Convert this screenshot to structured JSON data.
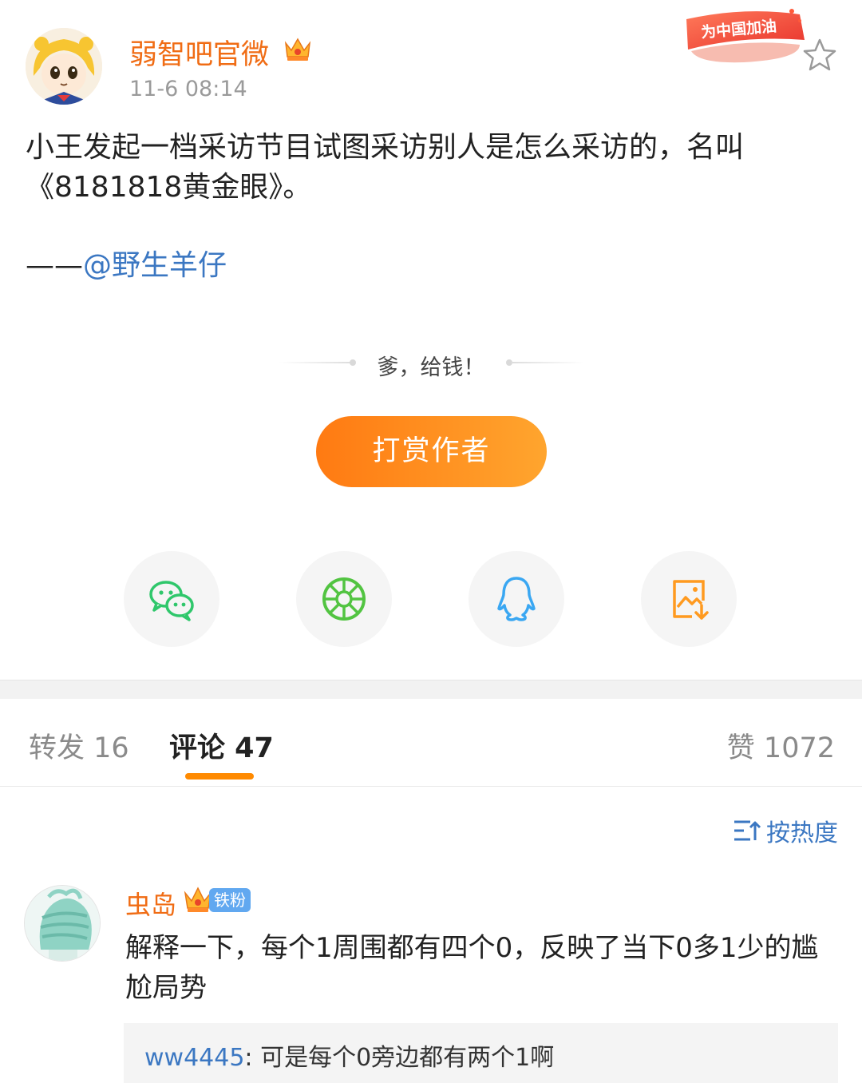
{
  "post": {
    "author": "弱智吧官微",
    "time": "11-6 08:14",
    "event_badge": "为中国加油",
    "body_lines": [
      "小王发起一档采访节目试图采访别人是怎么采访的，名叫",
      "《8181818黄金眼》。"
    ],
    "credit_dash": "——",
    "credit_mention": "@野生羊仔"
  },
  "reward": {
    "tip": "爹，给钱！",
    "button_label": "打赏作者"
  },
  "share": {
    "icons": [
      "wechat-icon",
      "moments-icon",
      "qq-icon",
      "save-image-icon"
    ]
  },
  "tabs": {
    "repost": "转发 16",
    "comment": "评论 47",
    "like": "赞 1072"
  },
  "sort": {
    "label": "按热度"
  },
  "comment": {
    "user": "虫岛",
    "badge": "铁粉",
    "text": "解释一下，每个1周围都有四个0，反映了当下0多1少的尴尬局势",
    "reply": {
      "user": "ww4445",
      "separator": ": ",
      "text": "可是每个0旁边都有两个1啊"
    }
  },
  "colors": {
    "accent": "#ff8a00",
    "username": "#f06c14",
    "link": "#3b77c2",
    "wechat": "#2fc76b",
    "moments": "#52c441",
    "qq": "#3aa7f2",
    "save": "#ff9a1f"
  }
}
